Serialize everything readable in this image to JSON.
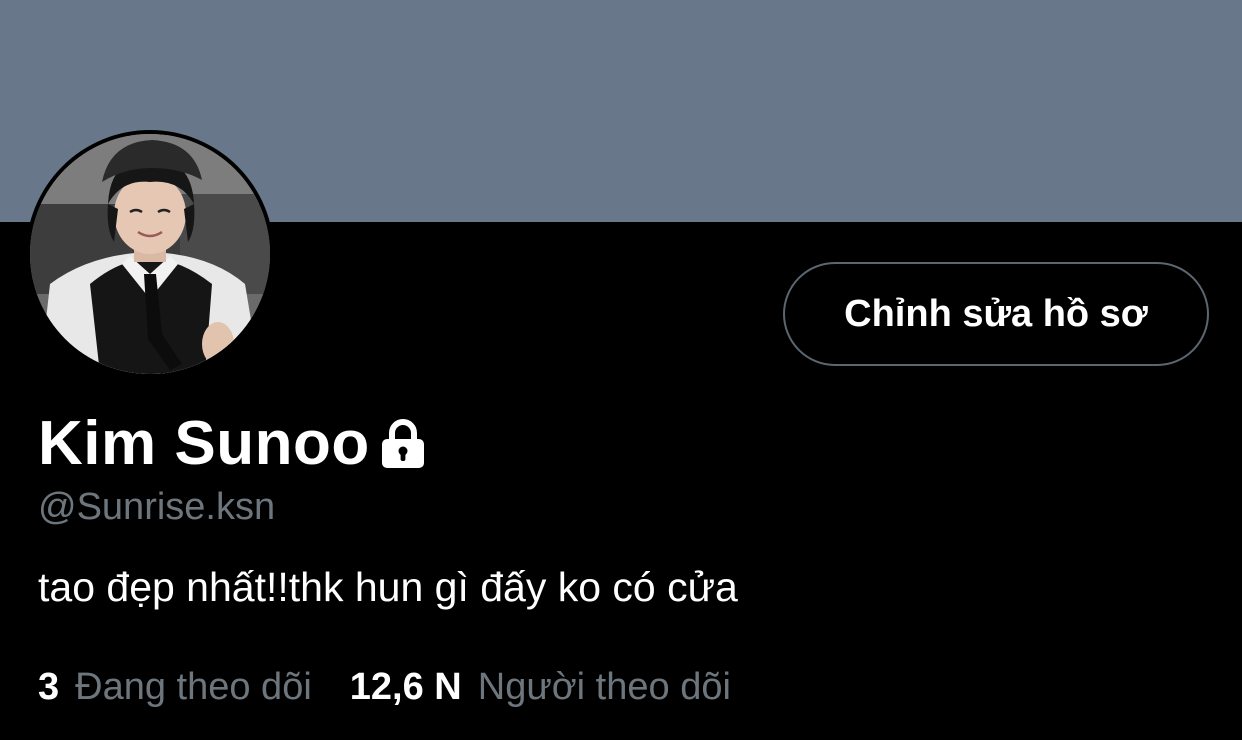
{
  "profile": {
    "display_name": "Kim Sunoo",
    "handle": "@Sunrise.ksn",
    "bio": "tao đẹp nhất!!thk hun gì đấy ko có cửa",
    "protected_icon": "lock-icon",
    "banner_color": "#68788a"
  },
  "actions": {
    "edit_profile_label": "Chỉnh sửa hồ sơ"
  },
  "stats": {
    "following_count": "3",
    "following_label": "Đang theo dõi",
    "followers_count": "12,6 N",
    "followers_label": "Người theo dõi"
  },
  "colors": {
    "background": "#000000",
    "text_primary": "#ffffff",
    "text_secondary": "#6e767d",
    "button_border": "#5b6670"
  }
}
